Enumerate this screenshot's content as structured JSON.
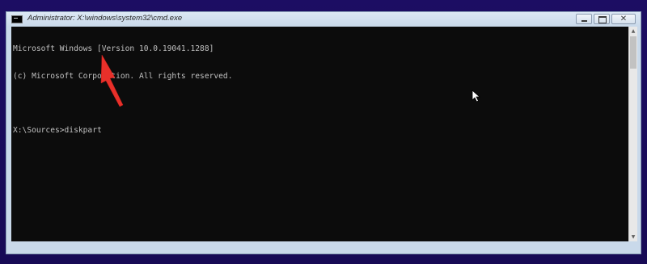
{
  "window": {
    "title": "Administrator: X:\\windows\\system32\\cmd.exe",
    "icon": "cmd-icon",
    "controls": {
      "minimize": "minimize-icon",
      "maximize": "maximize-icon",
      "close": "✕"
    }
  },
  "console": {
    "lines": [
      "Microsoft Windows [Version 10.0.19041.1288]",
      "(c) Microsoft Corporation. All rights reserved.",
      "",
      "X:\\Sources>diskpart"
    ],
    "text_color": "#c0c0c0",
    "background": "#0c0c0c"
  },
  "annotation": {
    "icon": "red-arrow-icon",
    "color": "#e8302a"
  },
  "cursor": {
    "icon": "mouse-pointer-icon"
  },
  "colors": {
    "desktop": "#1a0b5e",
    "window_frame": "#c9d9ea"
  }
}
